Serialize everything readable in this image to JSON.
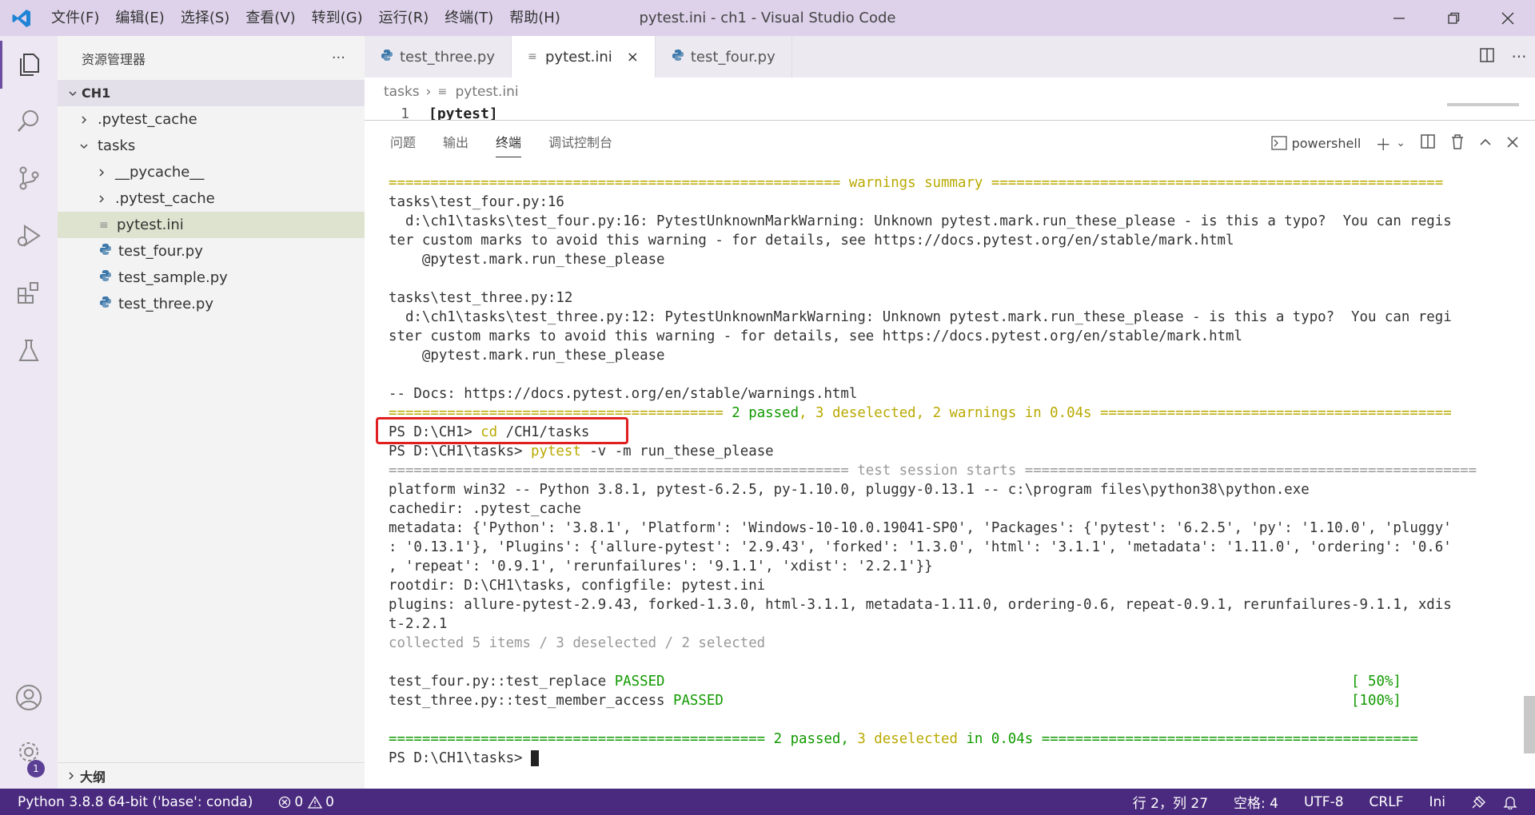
{
  "window": {
    "title": "pytest.ini - ch1 - Visual Studio Code",
    "menu": [
      "文件(F)",
      "编辑(E)",
      "选择(S)",
      "查看(V)",
      "转到(G)",
      "运行(R)",
      "终端(T)",
      "帮助(H)"
    ]
  },
  "sidebar": {
    "title": "资源管理器",
    "more": "···",
    "root": "CH1",
    "items": [
      {
        "label": ".pytest_cache",
        "indent": 1,
        "kind": "folder",
        "expanded": false
      },
      {
        "label": "tasks",
        "indent": 1,
        "kind": "folder",
        "expanded": true
      },
      {
        "label": "__pycache__",
        "indent": 2,
        "kind": "folder",
        "expanded": false
      },
      {
        "label": ".pytest_cache",
        "indent": 2,
        "kind": "folder",
        "expanded": false
      },
      {
        "label": "pytest.ini",
        "indent": 2,
        "kind": "ini",
        "selected": true
      },
      {
        "label": "test_four.py",
        "indent": 2,
        "kind": "py"
      },
      {
        "label": "test_sample.py",
        "indent": 2,
        "kind": "py"
      },
      {
        "label": "test_three.py",
        "indent": 2,
        "kind": "py"
      }
    ],
    "outline": "大纲"
  },
  "tabs": [
    {
      "label": "test_three.py",
      "kind": "py",
      "active": false
    },
    {
      "label": "pytest.ini",
      "kind": "ini",
      "active": true,
      "close": "×"
    },
    {
      "label": "test_four.py",
      "kind": "py",
      "active": false
    }
  ],
  "breadcrumb": {
    "folder": "tasks",
    "file": "pytest.ini"
  },
  "editor": {
    "line_number": "1",
    "line_text": "[pytest]"
  },
  "panel": {
    "tabs": [
      "问题",
      "输出",
      "终端",
      "调试控制台"
    ],
    "active_tab": "终端",
    "shell": "powershell"
  },
  "terminal_lines": [
    [
      {
        "t": "====================================================== ",
        "c": "c-yellow"
      },
      {
        "t": "warnings summary",
        "c": "c-yellow"
      },
      {
        "t": " ======================================================",
        "c": "c-yellow"
      }
    ],
    [
      {
        "t": "tasks\\test_four.py:16"
      }
    ],
    [
      {
        "t": "  d:\\ch1\\tasks\\test_four.py:16: PytestUnknownMarkWarning: Unknown pytest.mark.run_these_please - is this a typo?  You can regis"
      }
    ],
    [
      {
        "t": "ter custom marks to avoid this warning - for details, see https://docs.pytest.org/en/stable/mark.html"
      }
    ],
    [
      {
        "t": "    @pytest.mark.run_these_please"
      }
    ],
    [
      {
        "t": ""
      }
    ],
    [
      {
        "t": "tasks\\test_three.py:12"
      }
    ],
    [
      {
        "t": "  d:\\ch1\\tasks\\test_three.py:12: PytestUnknownMarkWarning: Unknown pytest.mark.run_these_please - is this a typo?  You can regi"
      }
    ],
    [
      {
        "t": "ster custom marks to avoid this warning - for details, see https://docs.pytest.org/en/stable/mark.html"
      }
    ],
    [
      {
        "t": "    @pytest.mark.run_these_please"
      }
    ],
    [
      {
        "t": ""
      }
    ],
    [
      {
        "t": "-- Docs: https://docs.pytest.org/en/stable/warnings.html"
      }
    ],
    [
      {
        "t": "======================================== ",
        "c": "c-yellow"
      },
      {
        "t": "2 passed",
        "c": "c-green"
      },
      {
        "t": ", ",
        "c": "c-yellow"
      },
      {
        "t": "3 deselected",
        "c": "c-yellow"
      },
      {
        "t": ", ",
        "c": "c-yellow"
      },
      {
        "t": "2 warnings",
        "c": "c-yellow"
      },
      {
        "t": " in 0.04s",
        "c": "c-yellow"
      },
      {
        "t": " ==========================================",
        "c": "c-yellow"
      }
    ],
    [
      {
        "t": "PS D:\\CH1> "
      },
      {
        "t": "cd",
        "c": "c-cmd"
      },
      {
        "t": " /CH1/tasks"
      }
    ],
    [
      {
        "t": "PS D:\\CH1\\tasks> "
      },
      {
        "t": "pytest",
        "c": "c-cmd"
      },
      {
        "t": " -v -m run_these_please"
      }
    ],
    [
      {
        "t": "======================================================= test session starts ======================================================",
        "c": "c-gray"
      }
    ],
    [
      {
        "t": "platform win32 -- Python 3.8.1, pytest-6.2.5, py-1.10.0, pluggy-0.13.1 -- c:\\program files\\python38\\python.exe"
      }
    ],
    [
      {
        "t": "cachedir: .pytest_cache"
      }
    ],
    [
      {
        "t": "metadata: {'Python': '3.8.1', 'Platform': 'Windows-10-10.0.19041-SP0', 'Packages': {'pytest': '6.2.5', 'py': '1.10.0', 'pluggy'"
      }
    ],
    [
      {
        "t": ": '0.13.1'}, 'Plugins': {'allure-pytest': '2.9.43', 'forked': '1.3.0', 'html': '3.1.1', 'metadata': '1.11.0', 'ordering': '0.6'"
      }
    ],
    [
      {
        "t": ", 'repeat': '0.9.1', 'rerunfailures': '9.1.1', 'xdist': '2.2.1'}}"
      }
    ],
    [
      {
        "t": "rootdir: D:\\CH1\\tasks, configfile: pytest.ini"
      }
    ],
    [
      {
        "t": "plugins: allure-pytest-2.9.43, forked-1.3.0, html-3.1.1, metadata-1.11.0, ordering-0.6, repeat-0.9.1, rerunfailures-9.1.1, xdis"
      }
    ],
    [
      {
        "t": "t-2.2.1"
      }
    ],
    [
      {
        "t": "collected 5 items / 3 deselected / 2 selected",
        "c": "c-gray"
      }
    ],
    [
      {
        "t": ""
      }
    ],
    [
      {
        "t": "test_four.py::test_replace "
      },
      {
        "t": "PASSED",
        "c": "c-green"
      },
      {
        "t": "                                                                                  "
      },
      {
        "t": "[ 50%]",
        "c": "c-green"
      }
    ],
    [
      {
        "t": "test_three.py::test_member_access "
      },
      {
        "t": "PASSED",
        "c": "c-green"
      },
      {
        "t": "                                                                           "
      },
      {
        "t": "[100%]",
        "c": "c-green"
      }
    ],
    [
      {
        "t": ""
      }
    ],
    [
      {
        "t": "============================================= ",
        "c": "c-green"
      },
      {
        "t": "2 passed",
        "c": "c-green"
      },
      {
        "t": ", ",
        "c": "c-green"
      },
      {
        "t": "3 deselected",
        "c": "c-yellow"
      },
      {
        "t": " in 0.04s",
        "c": "c-green"
      },
      {
        "t": " =============================================",
        "c": "c-green"
      }
    ],
    [
      {
        "t": "PS D:\\CH1\\tasks> "
      },
      {
        "t": "",
        "cursor": true
      }
    ]
  ],
  "statusbar": {
    "python": "Python 3.8.8 64-bit ('base': conda)",
    "errors": "0",
    "warnings": "0",
    "position": "行 2，列 27",
    "spaces": "空格: 4",
    "encoding": "UTF-8",
    "eol": "CRLF",
    "language": "Ini"
  },
  "colors": {
    "titlebar": "#ddd2ea",
    "statusbar": "#4a2a7e",
    "terminal_yellow": "#b9a900",
    "terminal_green": "#119a00",
    "highlight_box": "#e02020"
  }
}
